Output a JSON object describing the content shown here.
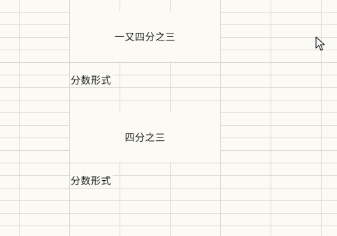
{
  "sheet": {
    "merged_cells": [
      {
        "value": "一又四分之三",
        "note": "分数形式"
      },
      {
        "value": "四分之三",
        "note": "分数形式"
      }
    ]
  },
  "icons": {
    "cursor": "mouse-pointer-icon"
  }
}
